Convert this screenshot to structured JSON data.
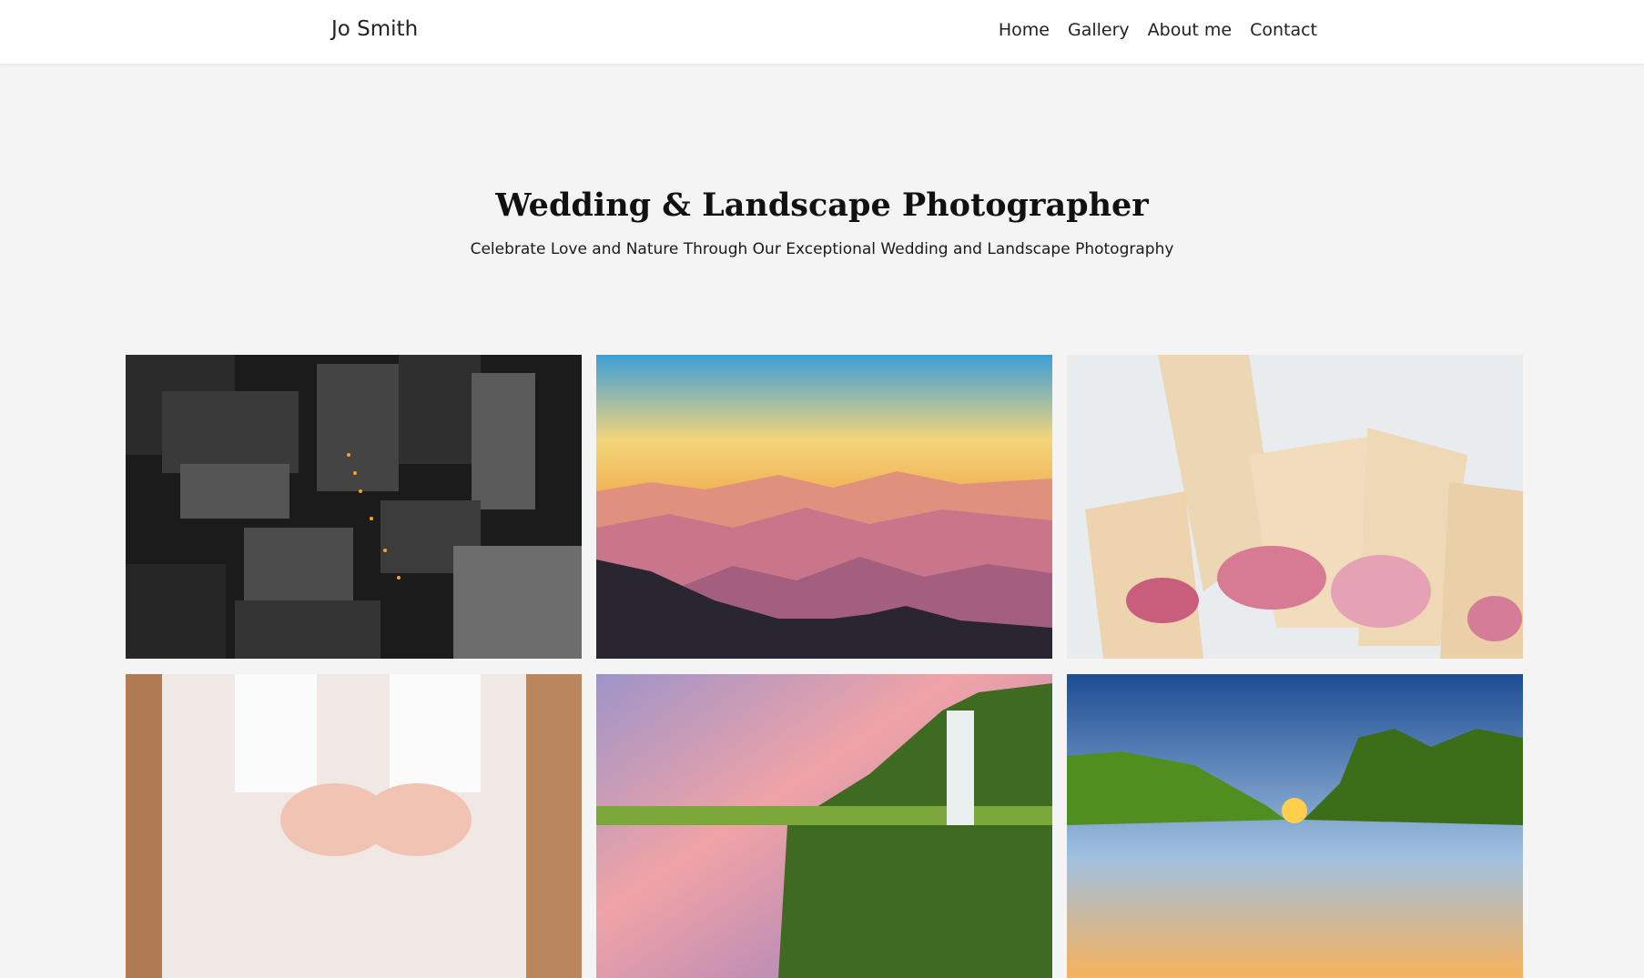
{
  "header": {
    "brand": "Jo Smith",
    "nav": [
      {
        "label": "Home"
      },
      {
        "label": "Gallery"
      },
      {
        "label": "About me"
      },
      {
        "label": "Contact"
      }
    ]
  },
  "hero": {
    "title": "Wedding & Landscape Photographer",
    "subtitle": "Celebrate Love and Nature Through Our Exceptional Wedding and Landscape Photography"
  },
  "colors": {
    "page_background": "#f4f4f4",
    "header_background": "#ffffff",
    "text": "#1a1a1a"
  }
}
